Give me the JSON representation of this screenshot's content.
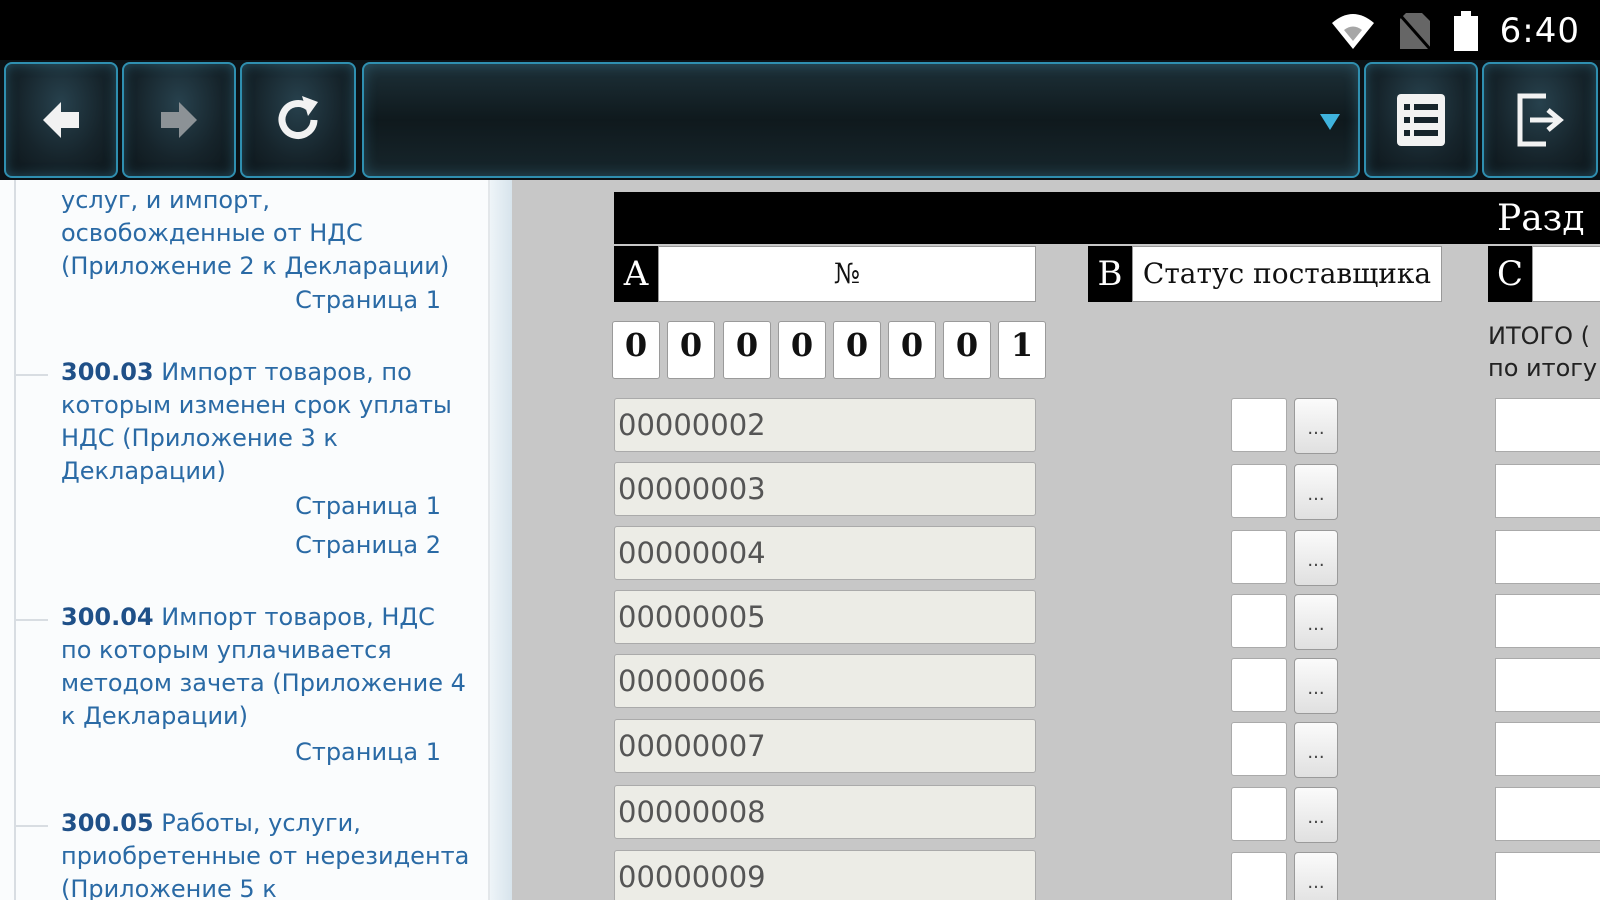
{
  "status_bar": {
    "time": "6:40",
    "icons": [
      "wifi-icon",
      "no-sim-icon",
      "battery-icon"
    ]
  },
  "toolbar": {
    "buttons": [
      "back-arrow-icon",
      "forward-arrow-icon",
      "refresh-icon",
      "list-icon",
      "exit-icon"
    ],
    "address_text": "",
    "accent_color": "#2f8fb0"
  },
  "tree": {
    "items": [
      {
        "code": "",
        "text": "услуг, и импорт, освобожденные от НДС (Приложение 2 к Декларации)",
        "pages": [
          "Страница 1"
        ]
      },
      {
        "code": "300.03",
        "text": "Импорт товаров, по которым изменен срок уплаты НДС (Приложение 3 к Декларации)",
        "pages": [
          "Страница 1",
          "Страница 2"
        ]
      },
      {
        "code": "300.04",
        "text": "Импорт товаров, НДС по которым уплачивается методом зачета (Приложение 4 к Декларации)",
        "pages": [
          "Страница 1"
        ]
      },
      {
        "code": "300.05",
        "text": "Работы, услуги, приобретенные от нерезидента (Приложение 5 к",
        "pages": []
      }
    ]
  },
  "form": {
    "section_title": "Разд",
    "columns": [
      {
        "letter": "A",
        "header": "№"
      },
      {
        "letter": "B",
        "header": "Статус поставщика"
      },
      {
        "letter": "C",
        "header": ""
      }
    ],
    "number_digits": [
      "0",
      "0",
      "0",
      "0",
      "0",
      "0",
      "0",
      "1"
    ],
    "itogo_line1": "ИТОГО (",
    "itogo_line2": "по итогу",
    "dots_label": "...",
    "rows": [
      "00000002",
      "00000003",
      "00000004",
      "00000005",
      "00000006",
      "00000007",
      "00000008",
      "00000009"
    ]
  }
}
